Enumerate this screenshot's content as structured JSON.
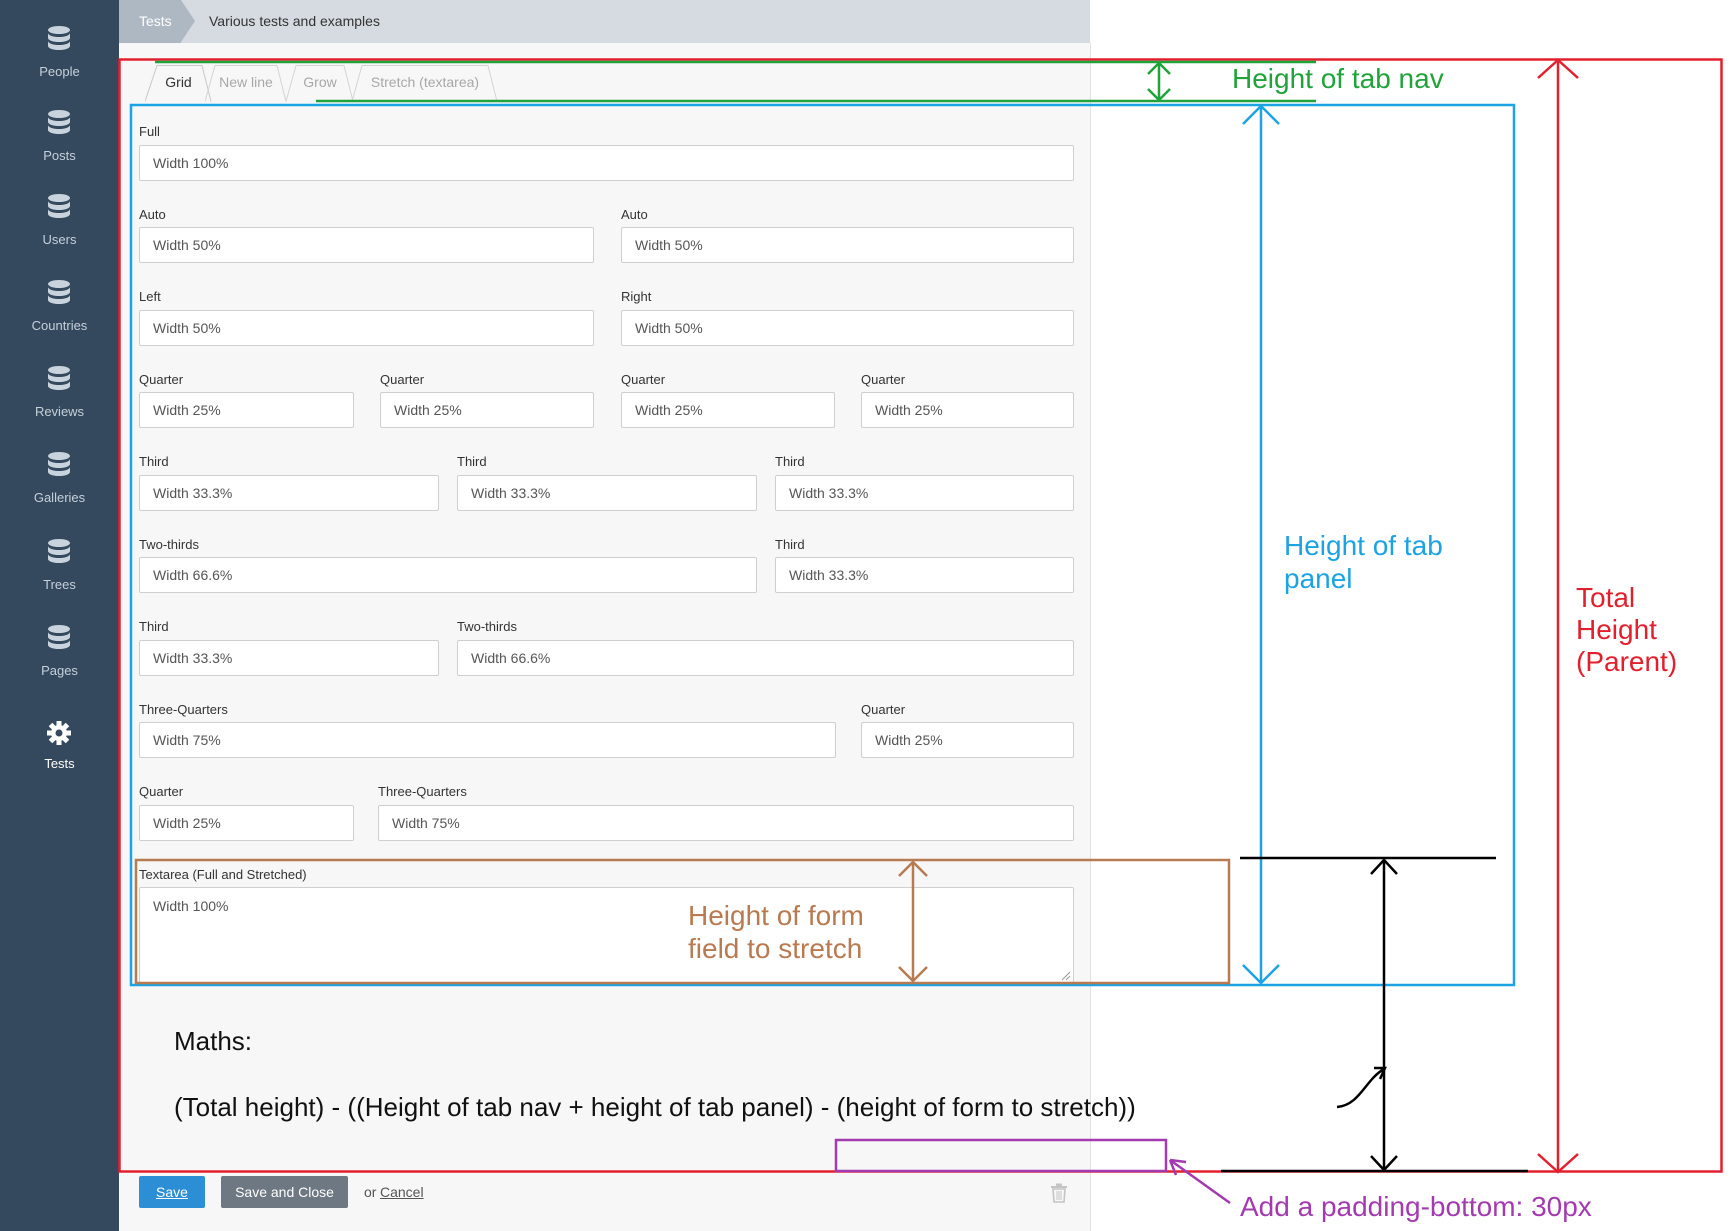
{
  "sidebar": {
    "items": [
      {
        "label": "People",
        "icon": "database-icon"
      },
      {
        "label": "Posts",
        "icon": "database-icon"
      },
      {
        "label": "Users",
        "icon": "database-icon"
      },
      {
        "label": "Countries",
        "icon": "database-icon"
      },
      {
        "label": "Reviews",
        "icon": "database-icon"
      },
      {
        "label": "Galleries",
        "icon": "database-icon"
      },
      {
        "label": "Trees",
        "icon": "database-icon"
      },
      {
        "label": "Pages",
        "icon": "database-icon"
      },
      {
        "label": "Tests",
        "icon": "gear-icon",
        "active": true
      }
    ]
  },
  "breadcrumb": {
    "first": "Tests",
    "second": "Various tests and examples"
  },
  "tabs": [
    {
      "label": "Grid",
      "active": true
    },
    {
      "label": "New line"
    },
    {
      "label": "Grow"
    },
    {
      "label": "Stretch (textarea)"
    }
  ],
  "fields": [
    {
      "label": "Full",
      "value": "Width 100%"
    },
    {
      "label": "Auto",
      "value": "Width 50%"
    },
    {
      "label": "Auto",
      "value": "Width 50%"
    },
    {
      "label": "Left",
      "value": "Width 50%"
    },
    {
      "label": "Right",
      "value": "Width 50%"
    },
    {
      "label": "Quarter",
      "value": "Width 25%"
    },
    {
      "label": "Quarter",
      "value": "Width 25%"
    },
    {
      "label": "Quarter",
      "value": "Width 25%"
    },
    {
      "label": "Quarter",
      "value": "Width 25%"
    },
    {
      "label": "Third",
      "value": "Width 33.3%"
    },
    {
      "label": "Third",
      "value": "Width 33.3%"
    },
    {
      "label": "Third",
      "value": "Width 33.3%"
    },
    {
      "label": "Two-thirds",
      "value": "Width 66.6%"
    },
    {
      "label": "Third",
      "value": "Width 33.3%"
    },
    {
      "label": "Third",
      "value": "Width 33.3%"
    },
    {
      "label": "Two-thirds",
      "value": "Width 66.6%"
    },
    {
      "label": "Three-Quarters",
      "value": "Width 75%"
    },
    {
      "label": "Quarter",
      "value": "Width 25%"
    },
    {
      "label": "Quarter",
      "value": "Width 25%"
    },
    {
      "label": "Three-Quarters",
      "value": "Width 75%"
    }
  ],
  "textarea": {
    "label": "Textarea (Full and Stretched)",
    "value": "Width 100%"
  },
  "footer": {
    "save": "Save",
    "save_close": "Save and Close",
    "or": "or",
    "cancel": "Cancel"
  },
  "annotations": {
    "tab_nav": "Height of tab nav",
    "tab_panel_1": "Height of tab",
    "tab_panel_2": "panel",
    "total_1": "Total",
    "total_2": "Height",
    "total_3": "(Parent)",
    "form_field_1": "Height of form",
    "form_field_2": "field to stretch",
    "maths_title": "Maths:",
    "maths_formula": "(Total height) - ((Height of tab nav + height of tab panel) - (height of form to stretch))",
    "padding": "Add a padding-bottom: 30px"
  },
  "colors": {
    "sidebar_bg": "#34495e",
    "save_button": "#2c8fd6",
    "save_close_button": "#6e7882",
    "total_annotation": "#e2202d",
    "tab_nav_annotation": "#1fa33a",
    "tab_panel_annotation": "#1ca3e3",
    "form_field_annotation": "#b87a50",
    "padding_annotation": "#a33ab0"
  }
}
